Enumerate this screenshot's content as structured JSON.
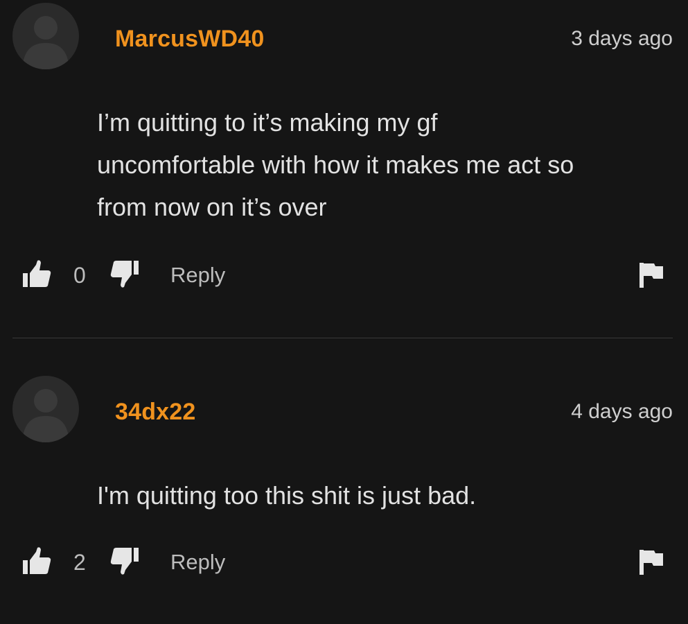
{
  "comments": [
    {
      "username": "MarcusWD40",
      "timestamp": "3 days ago",
      "text_lines": [
        "I’m quitting to it’s making my gf",
        "uncomfortable with how it makes me act so",
        "from now on it’s over"
      ],
      "votes": "0",
      "reply_label": "Reply"
    },
    {
      "username": "34dx22",
      "timestamp": "4 days ago",
      "text_lines": [
        "I'm quitting too this shit is just bad."
      ],
      "votes": "2",
      "reply_label": "Reply"
    }
  ],
  "colors": {
    "background": "#151515",
    "username": "#f0921e",
    "text": "#e2e2e2",
    "muted": "#bdbdbd",
    "icon": "#e6e6e6",
    "avatar": "#2b2b2b"
  },
  "icons": {
    "avatar": "user-silhouette-icon",
    "upvote": "thumbs-up-icon",
    "downvote": "thumbs-down-icon",
    "report": "flag-icon"
  }
}
